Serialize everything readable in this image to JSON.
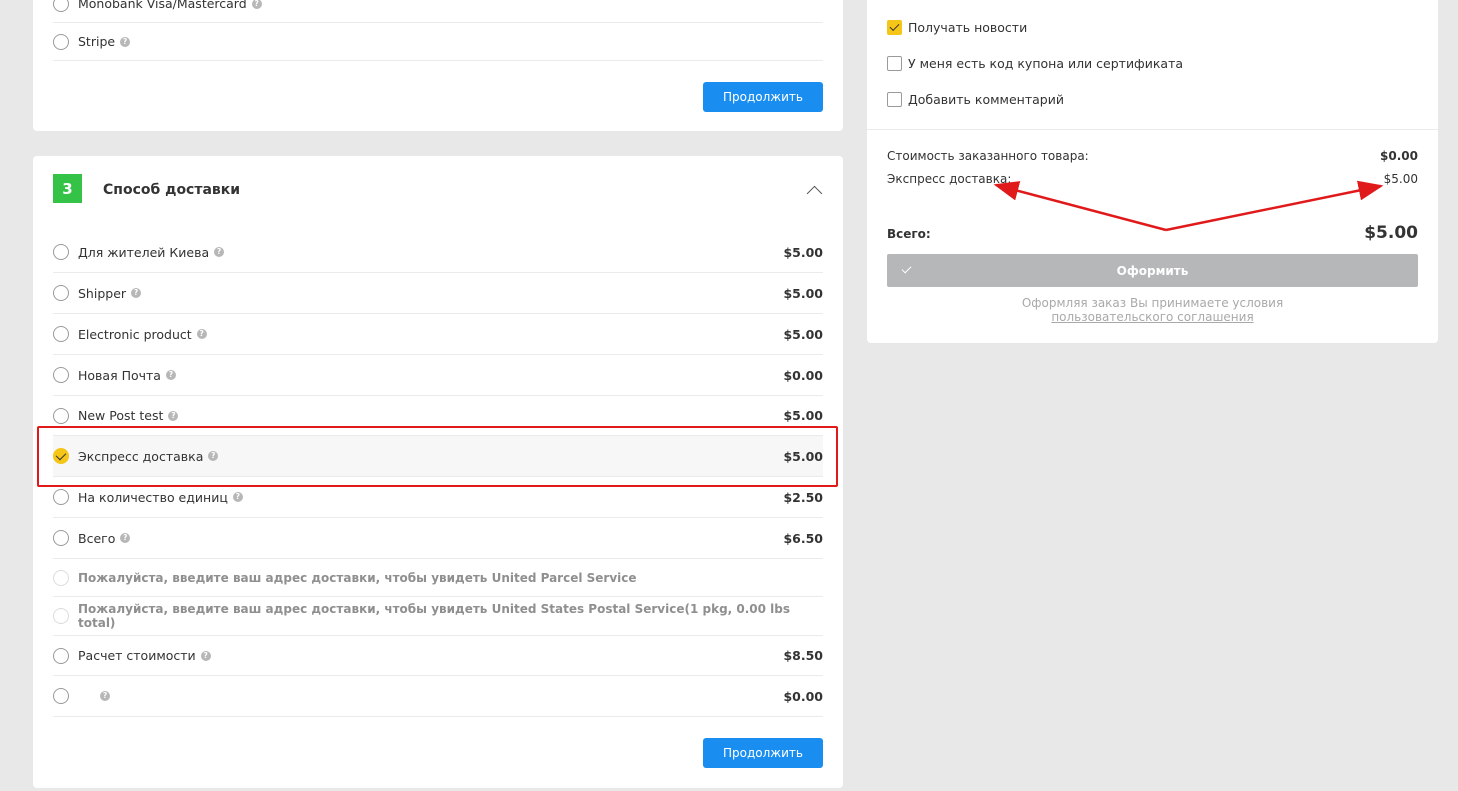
{
  "payment": {
    "methods": [
      {
        "label": "Monobank Visa/Mastercard"
      },
      {
        "label": "Stripe"
      }
    ],
    "continue_label": "Продолжить"
  },
  "shipping": {
    "step_number": "3",
    "title": "Способ доставки",
    "methods": [
      {
        "label": "Для жителей Киева",
        "price": "$5.00",
        "selected": false
      },
      {
        "label": "Shipper",
        "price": "$5.00",
        "selected": false
      },
      {
        "label": "Electronic product",
        "price": "$5.00",
        "selected": false
      },
      {
        "label": "Новая Почта",
        "price": "$0.00",
        "selected": false
      },
      {
        "label": "New Post test",
        "price": "$5.00",
        "selected": false
      },
      {
        "label": "Экспресс доставка",
        "price": "$5.00",
        "selected": true
      },
      {
        "label": "На количество единиц",
        "price": "$2.50",
        "selected": false
      },
      {
        "label": "Всего",
        "price": "$6.50",
        "selected": false
      },
      {
        "label": "Пожалуйста, введите ваш адрес доставки, чтобы увидеть United Parcel Service",
        "price": "",
        "disabled": true
      },
      {
        "label": "Пожалуйста, введите ваш адрес доставки, чтобы увидеть United States Postal Service(1 pkg, 0.00 lbs total)",
        "price": "",
        "disabled": true
      },
      {
        "label": "Расчет стоимости",
        "price": "$8.50",
        "selected": false
      },
      {
        "label": "",
        "price": "$0.00",
        "selected": false
      }
    ],
    "continue_label": "Продолжить"
  },
  "summary": {
    "options": [
      {
        "label": "Получать новости",
        "checked": true
      },
      {
        "label": "У меня есть код купона или сертификата",
        "checked": false
      },
      {
        "label": "Добавить комментарий",
        "checked": false
      }
    ],
    "goods_cost_label": "Стоимость заказанного товара:",
    "goods_cost_value": "$0.00",
    "shipping_label": "Экспресс доставка:",
    "shipping_value": "$5.00",
    "total_label": "Всего:",
    "total_value": "$5.00",
    "submit_label": "Оформить",
    "terms_text": "Оформляя заказ Вы принимаете условия",
    "terms_link": "пользовательского соглашения"
  },
  "colors": {
    "accent_blue": "#1a8ef0",
    "step_green": "#34c347",
    "check_yellow": "#f5c518",
    "annotation_red": "#e01a1a"
  }
}
